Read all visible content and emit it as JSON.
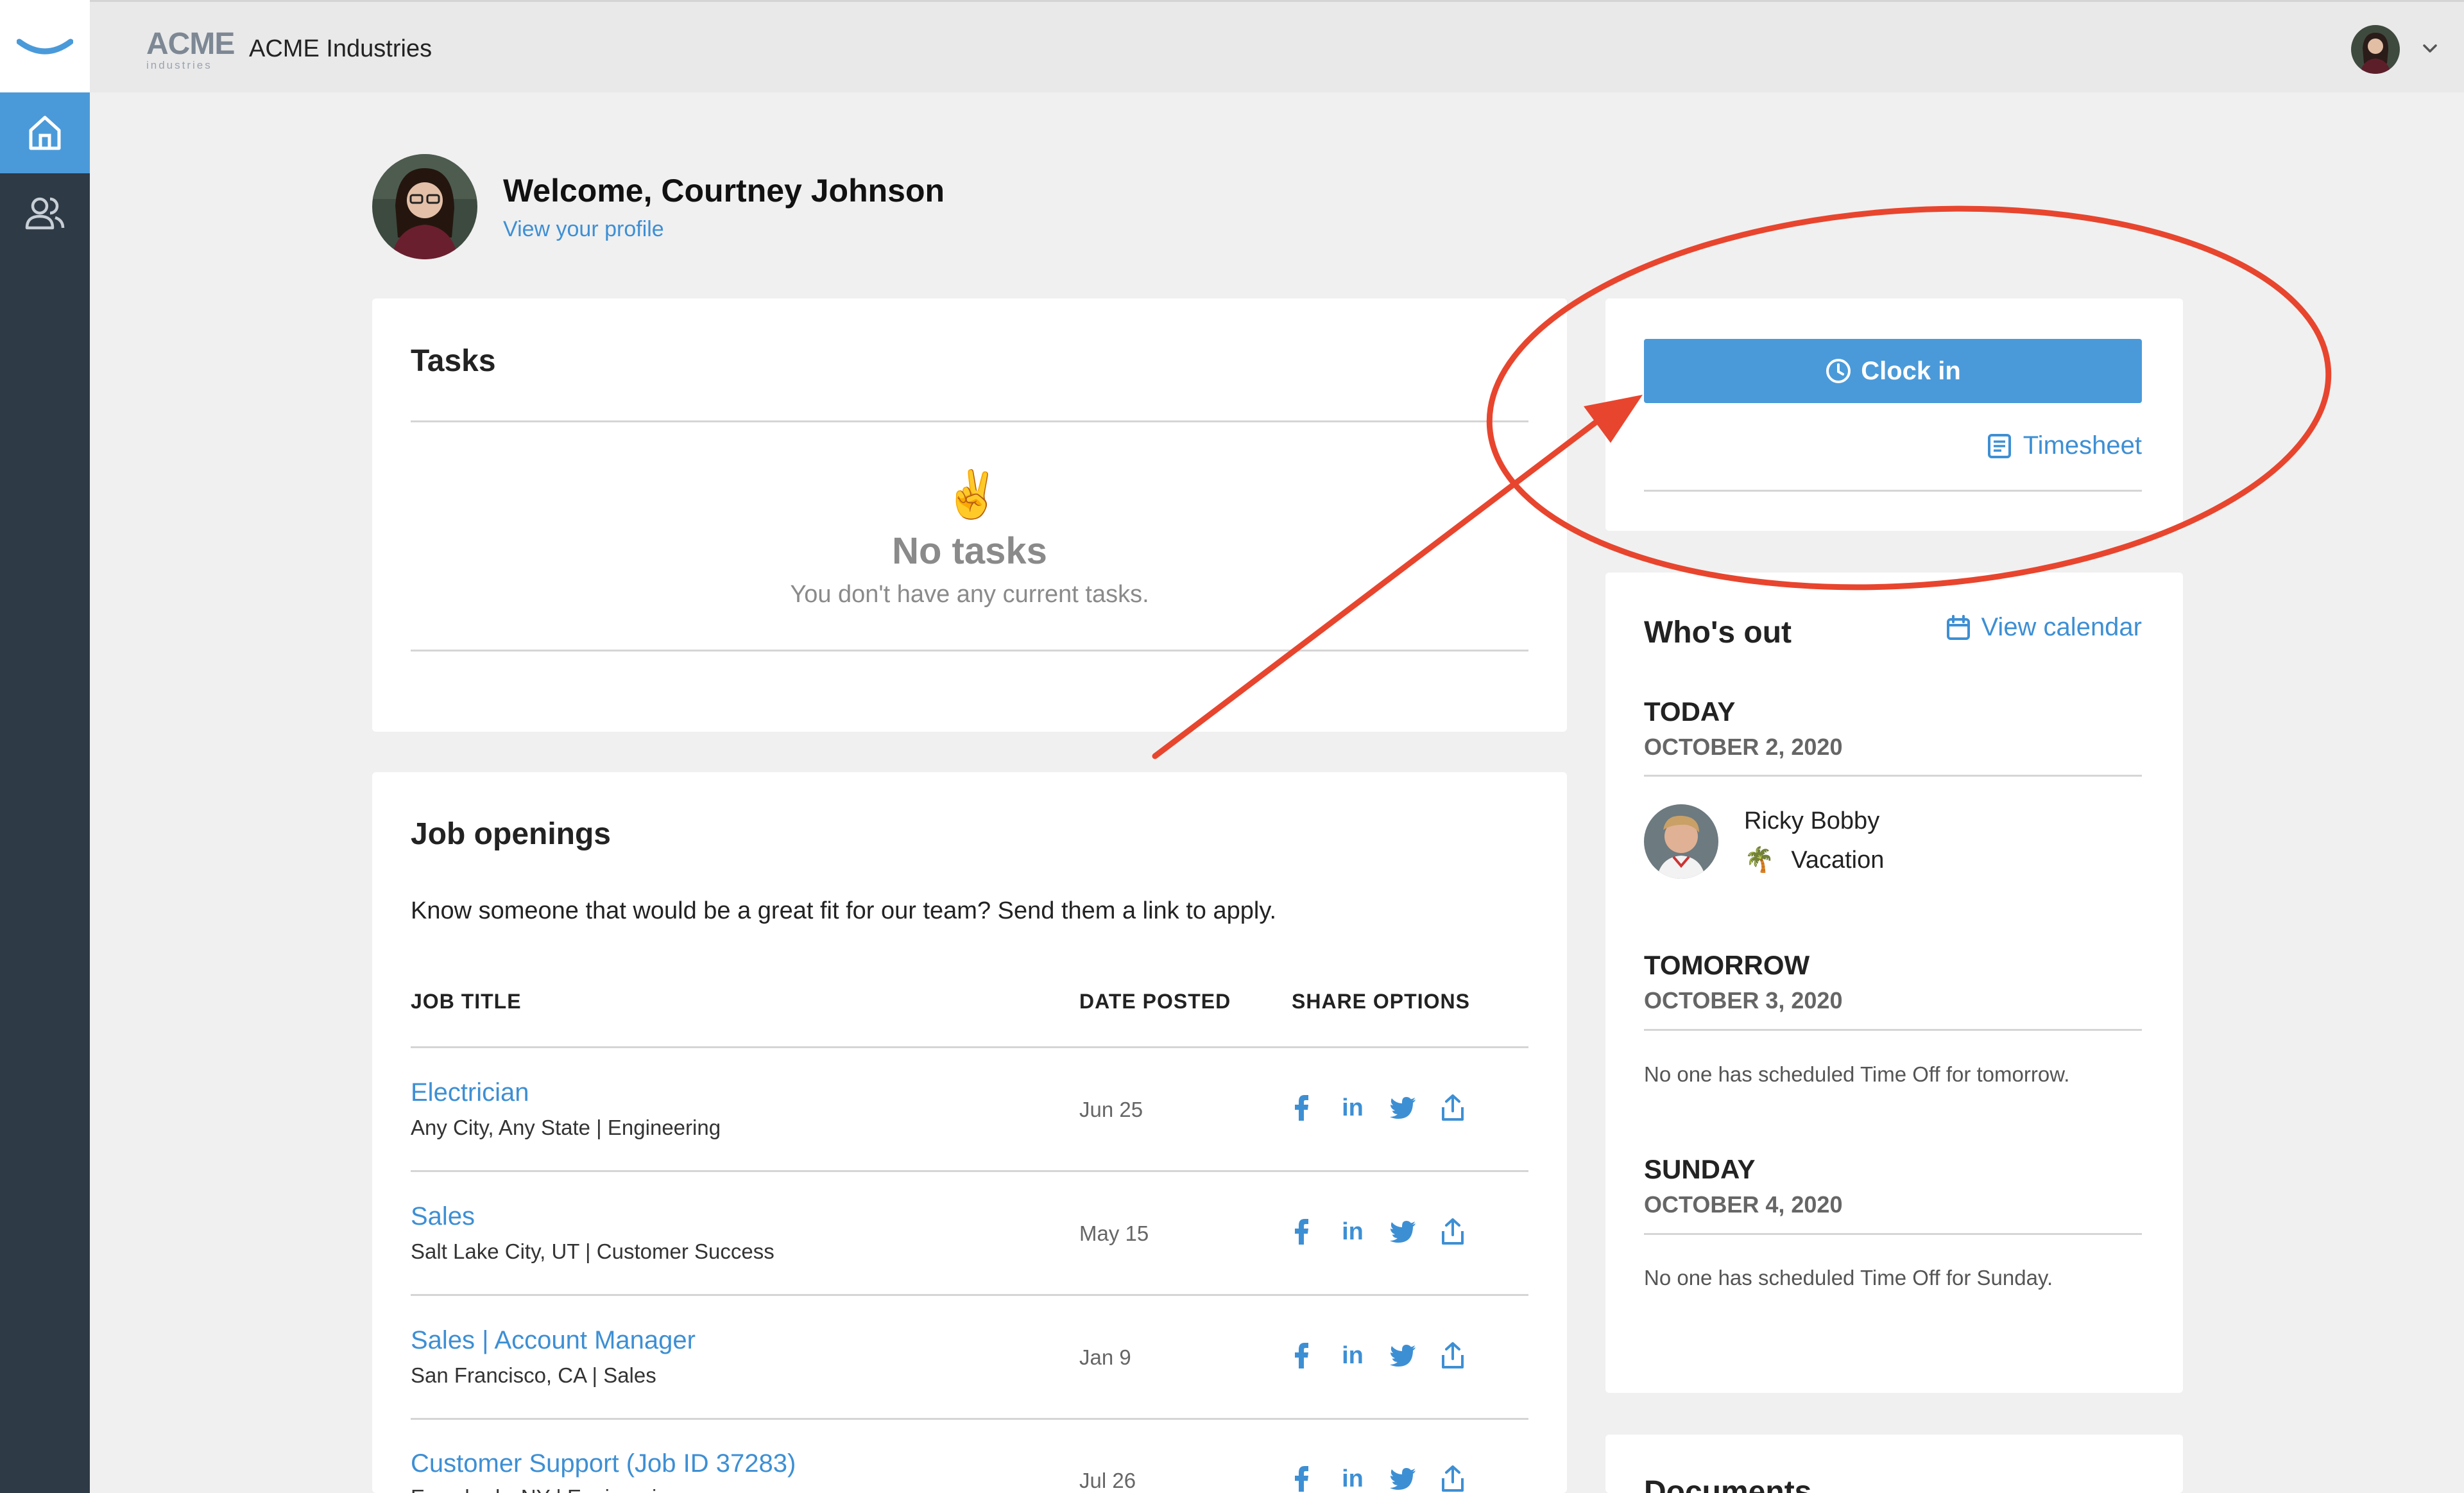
{
  "topbar": {
    "logo_word": "ACME",
    "logo_sub": "industries",
    "company_name": "ACME Industries"
  },
  "welcome": {
    "title": "Welcome, Courtney Johnson",
    "profile_link": "View your profile"
  },
  "tasks": {
    "title": "Tasks",
    "empty_icon": "✌️",
    "empty_title": "No tasks",
    "empty_subtitle": "You don't have any current tasks."
  },
  "clock": {
    "button_label": "Clock in",
    "timesheet_label": "Timesheet"
  },
  "whos_out": {
    "title": "Who's out",
    "view_calendar": "View calendar",
    "days": [
      {
        "label": "TODAY",
        "date": "OCTOBER 2, 2020"
      },
      {
        "label": "TOMORROW",
        "date": "OCTOBER 3, 2020",
        "empty": "No one has scheduled Time Off for tomorrow."
      },
      {
        "label": "SUNDAY",
        "date": "OCTOBER 4, 2020",
        "empty": "No one has scheduled Time Off for Sunday."
      }
    ],
    "person": {
      "name": "Ricky Bobby",
      "reason_icon": "🌴",
      "reason": "Vacation"
    }
  },
  "documents": {
    "title": "Documents"
  },
  "jobs": {
    "title": "Job openings",
    "intro": "Know someone that would be a great fit for our team? Send them a link to apply.",
    "headers": {
      "title": "JOB TITLE",
      "date": "DATE POSTED",
      "share": "SHARE OPTIONS"
    },
    "rows": [
      {
        "title": "Electrician",
        "sub": "Any City, Any State | Engineering",
        "date": "Jun 25"
      },
      {
        "title": "Sales",
        "sub": "Salt Lake City, UT | Customer Success",
        "date": "May 15"
      },
      {
        "title": "Sales | Account Manager",
        "sub": "San Francisco, CA | Sales",
        "date": "Jan 9"
      },
      {
        "title": "Customer Support (Job ID 37283)",
        "sub": "Everybody, NY | Engineering",
        "date": "Jul 26"
      }
    ]
  },
  "share_icons": {
    "facebook": "f",
    "linkedin": "in"
  },
  "colors": {
    "accent": "#4a9ad9",
    "sidebar": "#2e3a45",
    "annotation": "#e8452e"
  }
}
